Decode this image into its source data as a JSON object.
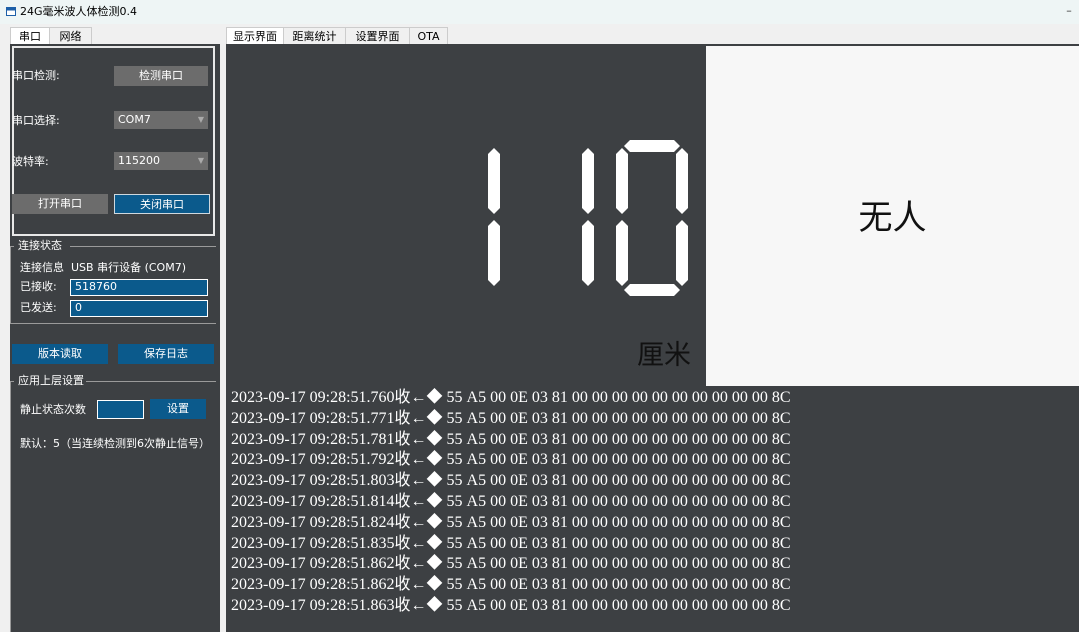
{
  "window": {
    "title": "24G毫米波人体检测0.4",
    "minimize_glyph": "–"
  },
  "left_tabs": [
    {
      "label": "串口",
      "active": true
    },
    {
      "label": "网络",
      "active": false
    }
  ],
  "serial": {
    "detect_label": "串口检测:",
    "detect_button": "检测串口",
    "port_label": "串口选择:",
    "port_value": "COM7",
    "baud_label": "波特率:",
    "baud_value": "115200",
    "open_button": "打开串口",
    "close_button": "关闭串口"
  },
  "connection": {
    "group_title": "连接状态",
    "info_label": "连接信息",
    "info_value": "USB 串行设备 (COM7)",
    "received_label": "已接收:",
    "received_value": "518760",
    "sent_label": "已发送:",
    "sent_value": "0"
  },
  "actions": {
    "read_version_button": "版本读取",
    "save_log_button": "保存日志"
  },
  "app_settings": {
    "group_title": "应用上层设置",
    "static_count_label": "静止状态次数",
    "static_count_value": "",
    "set_button": "设置",
    "default_note": "默认：5（当连续检测到6次静止信号）"
  },
  "right_tabs": [
    {
      "label": "显示界面",
      "active": true
    },
    {
      "label": "距离统计",
      "active": false
    },
    {
      "label": "设置界面",
      "active": false
    },
    {
      "label": "OTA",
      "active": false
    }
  ],
  "display": {
    "distance_value": "110",
    "unit": "厘米",
    "presence_status": "无人"
  },
  "log": [
    "2023-09-17 09:28:51.760收←◆ 55 A5 00 0E 03 81 00 00 00 00 00 00 00 00 00 00 8C",
    "2023-09-17 09:28:51.771收←◆ 55 A5 00 0E 03 81 00 00 00 00 00 00 00 00 00 00 8C",
    "2023-09-17 09:28:51.781收←◆ 55 A5 00 0E 03 81 00 00 00 00 00 00 00 00 00 00 8C",
    "2023-09-17 09:28:51.792收←◆ 55 A5 00 0E 03 81 00 00 00 00 00 00 00 00 00 00 8C",
    "2023-09-17 09:28:51.803收←◆ 55 A5 00 0E 03 81 00 00 00 00 00 00 00 00 00 00 8C",
    "2023-09-17 09:28:51.814收←◆ 55 A5 00 0E 03 81 00 00 00 00 00 00 00 00 00 00 8C",
    "2023-09-17 09:28:51.824收←◆ 55 A5 00 0E 03 81 00 00 00 00 00 00 00 00 00 00 8C",
    "2023-09-17 09:28:51.835收←◆ 55 A5 00 0E 03 81 00 00 00 00 00 00 00 00 00 00 8C",
    "2023-09-17 09:28:51.862收←◆ 55 A5 00 0E 03 81 00 00 00 00 00 00 00 00 00 00 8C",
    "2023-09-17 09:28:51.862收←◆ 55 A5 00 0E 03 81 00 00 00 00 00 00 00 00 00 00 8C",
    "2023-09-17 09:28:51.863收←◆ 55 A5 00 0E 03 81 00 00 00 00 00 00 00 00 00 00 8C"
  ]
}
